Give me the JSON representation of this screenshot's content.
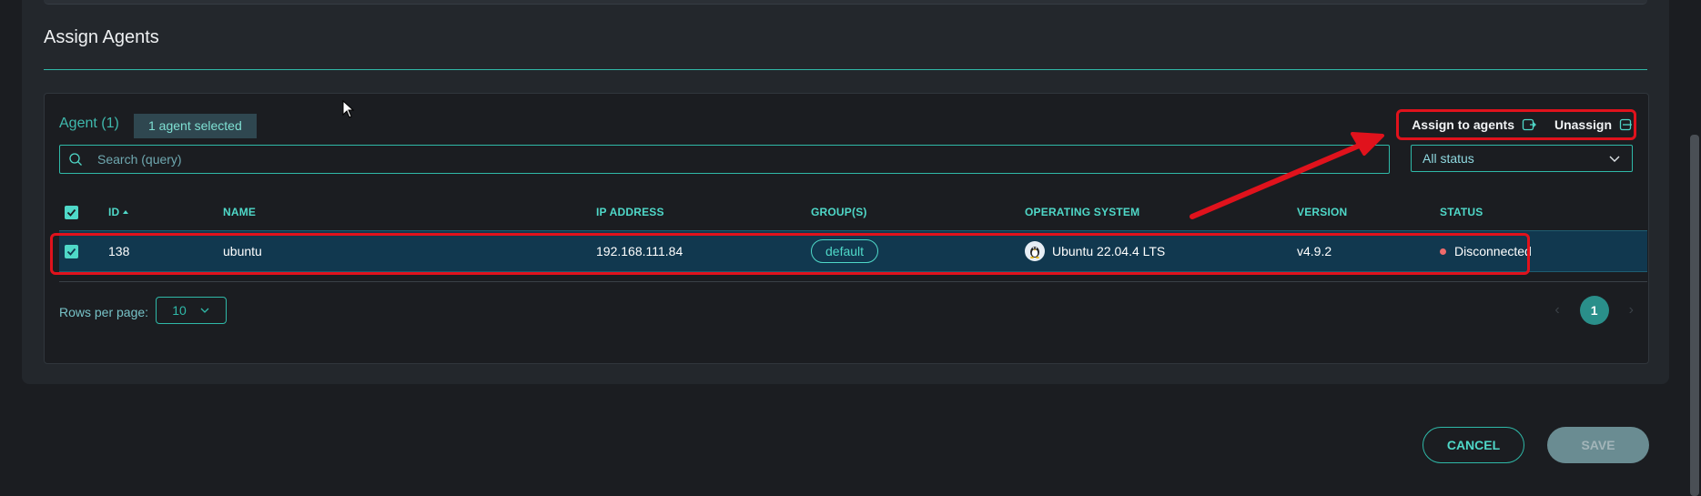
{
  "section": {
    "title": "Assign Agents"
  },
  "table": {
    "agent_count": "Agent (1)",
    "selected_label": "1 agent selected",
    "actions": {
      "assign_label": "Assign to agents",
      "unassign_label": "Unassign"
    },
    "search_placeholder": "Search (query)",
    "status_filter": "All status",
    "headers": {
      "id": "ID",
      "name": "NAME",
      "ip": "IP ADDRESS",
      "groups": "GROUP(S)",
      "os": "OPERATING SYSTEM",
      "version": "VERSION",
      "status": "STATUS"
    },
    "rows": [
      {
        "id": "138",
        "name": "ubuntu",
        "ip": "192.168.111.84",
        "group": "default",
        "os": "Ubuntu 22.04.4 LTS",
        "version": "v4.9.2",
        "status": "Disconnected",
        "selected": true
      }
    ],
    "rows_per_page_label": "Rows per page:",
    "rows_per_page": "10",
    "current_page": "1"
  },
  "footer": {
    "cancel_label": "CANCEL",
    "save_label": "SAVE"
  },
  "colors": {
    "accent": "#2fb9a8",
    "selected_row": "#11384f",
    "status_disconnected": "#ef6b6b",
    "annotation": "#e0121c"
  }
}
